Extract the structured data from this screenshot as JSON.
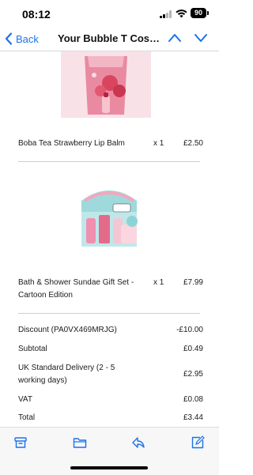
{
  "status": {
    "time": "08:12",
    "battery": "90"
  },
  "nav": {
    "back_label": "Back",
    "title": "Your Bubble T Cosme..."
  },
  "items": [
    {
      "name": "Boba Tea Strawberry Lip Balm",
      "qty": "x 1",
      "price": "£2.50"
    },
    {
      "name_line1": "Bath & Shower Sundae Gift Set -",
      "name_line2": "Cartoon Edition",
      "qty": "x 1",
      "price": "£7.99"
    }
  ],
  "summary": {
    "discount_label": "Discount (PA0VX469MRJG)",
    "discount_value": "-£10.00",
    "subtotal_label": "Subtotal",
    "subtotal_value": "£0.49",
    "delivery_label_line1": "UK Standard Delivery (2 - 5",
    "delivery_label_line2": "working days)",
    "delivery_value": "£2.95",
    "vat_label": "VAT",
    "vat_value": "£0.08",
    "total_label": "Total",
    "total_value": "£3.44"
  },
  "colors": {
    "accent": "#1a73e8",
    "divider": "#cfcfd4",
    "toolbar_bg": "#f7f7f8"
  },
  "icons": [
    "back-chevron-icon",
    "up-arrow-icon",
    "down-arrow-icon",
    "archive-icon",
    "folder-icon",
    "reply-icon",
    "compose-icon"
  ]
}
